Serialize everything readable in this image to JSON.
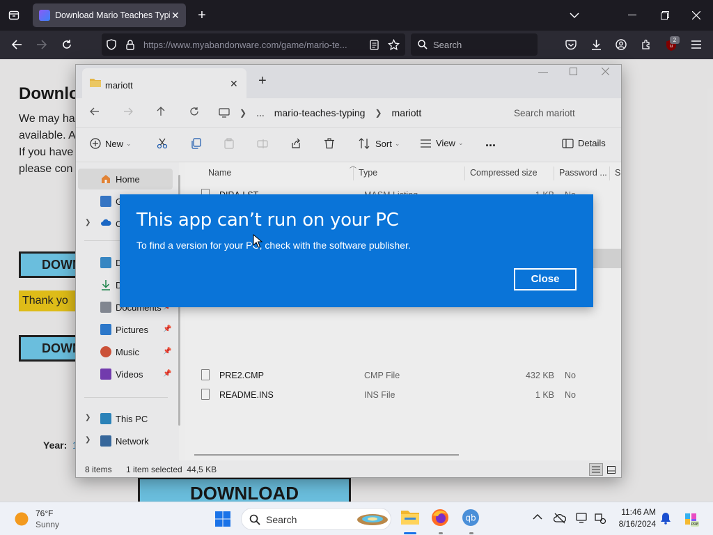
{
  "browser": {
    "tab_title": "Download Mario Teaches Typing",
    "url": "https://www.myabandonware.com/game/mario-te...",
    "search_placeholder": "Search",
    "extension_badge": "2"
  },
  "webpage": {
    "heading": "Download",
    "lines": [
      "We may ha",
      "available. A",
      "If you have",
      "please con"
    ],
    "download_label": "DOWN",
    "thank_label": "Thank yo",
    "year_label": "Year:",
    "year_value": "1",
    "big_download_label": "DOWNLOAD"
  },
  "explorer": {
    "tab_title": "mariott",
    "breadcrumb": [
      "...",
      "mario-teaches-typing",
      "mariott"
    ],
    "search_placeholder": "Search mariott",
    "toolbar": {
      "new": "New",
      "sort": "Sort",
      "view": "View",
      "more": "...",
      "details": "Details"
    },
    "sidebar": {
      "home": "Home",
      "gallery": "G",
      "onedrive": "O",
      "desktop": "D",
      "downloads": "D",
      "documents": "Documents",
      "pictures": "Pictures",
      "music": "Music",
      "videos": "Videos",
      "this_pc": "This PC",
      "network": "Network"
    },
    "columns": [
      "Name",
      "Type",
      "Compressed size",
      "Password ...",
      "Si"
    ],
    "files": [
      {
        "name": "DIRA.LST",
        "type": "MASM Listing",
        "size": "1 KB",
        "password": "No"
      },
      {
        "name": "PRE2.CMP",
        "type": "CMP File",
        "size": "432 KB",
        "password": "No"
      },
      {
        "name": "README.INS",
        "type": "INS File",
        "size": "1 KB",
        "password": "No"
      }
    ],
    "status": {
      "items": "8 items",
      "selected": "1 item selected  44,5 KB"
    }
  },
  "dialog": {
    "title": "This app can’t run on your PC",
    "message": "To find a version for your PC, check with the software publisher.",
    "close_label": "Close"
  },
  "taskbar": {
    "temperature": "76°F",
    "weather": "Sunny",
    "search_placeholder": "Search",
    "time": "11:46 AM",
    "date": "8/16/2024"
  }
}
